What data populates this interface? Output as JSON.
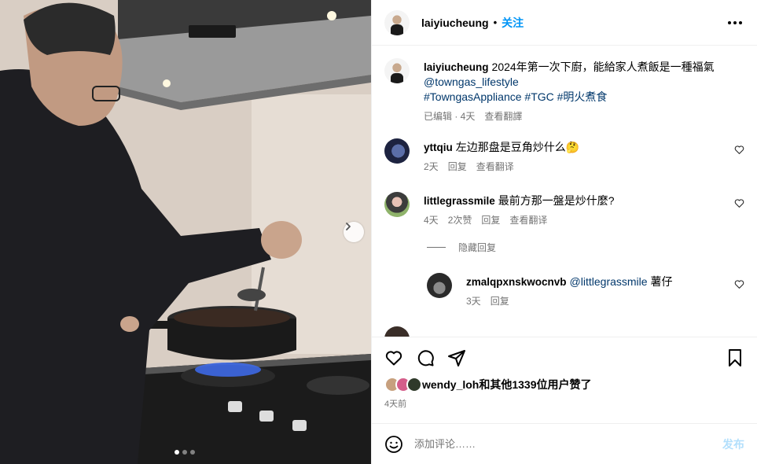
{
  "post": {
    "username": "laiyiucheung",
    "separator": "•",
    "follow_label": "关注",
    "more_icon": "more-horizontal-icon"
  },
  "caption": {
    "username": "laiyiucheung",
    "text": "2024年第一次下廚，能給家人煮飯是一種福氣",
    "mention": "@towngas_lifestyle",
    "hashtags": "#TowngasAppliance #TGC #明火煮食",
    "edited": "已编辑 · 4天",
    "translate": "查看翻譯"
  },
  "comments": [
    {
      "username": "yttqiu",
      "text": "左边那盘是豆角炒什么🤔",
      "time": "2天",
      "reply": "回复",
      "translate": "查看翻译"
    },
    {
      "username": "littlegrassmile",
      "text": "最前方那一盤是炒什麼?",
      "time": "4天",
      "likes": "2次赞",
      "reply": "回复",
      "translate": "查看翻译"
    }
  ],
  "hide_replies": "隐藏回复",
  "reply": {
    "username": "zmalqpxnskwocnvb",
    "mention": "@littlegrassmile",
    "text": "薯仔",
    "time": "3天",
    "reply": "回复"
  },
  "likes": {
    "user": "wendy_loh",
    "rest": "和其他1339位用户赞了"
  },
  "timestamp": "4天前",
  "comment_input": {
    "placeholder": "添加评论……",
    "post_label": "发布"
  },
  "colors": {
    "accent": "#0095f6",
    "link": "#00376b",
    "muted": "#737373",
    "post_disabled": "#b2dffc"
  }
}
